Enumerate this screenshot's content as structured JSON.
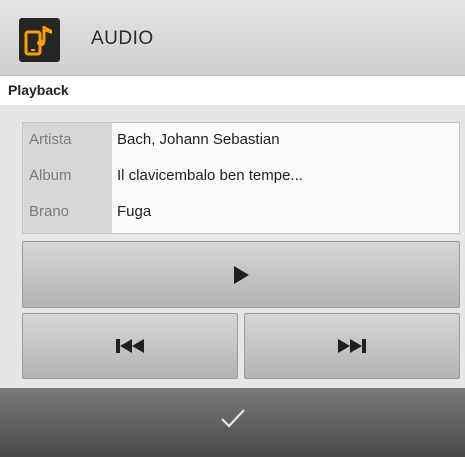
{
  "header": {
    "title": "AUDIO",
    "icon": "mobile-audio-icon",
    "icon_color": "#f5a100"
  },
  "subheader": {
    "title": "Playback"
  },
  "track_info": [
    {
      "label": "Artista",
      "value": "Bach, Johann Sebastian"
    },
    {
      "label": "Album",
      "value": "Il clavicembalo ben tempe..."
    },
    {
      "label": "Brano",
      "value": "Fuga"
    }
  ],
  "controls": {
    "play_icon": "play-icon",
    "previous_icon": "previous-track-icon",
    "next_icon": "next-track-icon"
  },
  "footer": {
    "confirm_icon": "checkmark-icon"
  }
}
